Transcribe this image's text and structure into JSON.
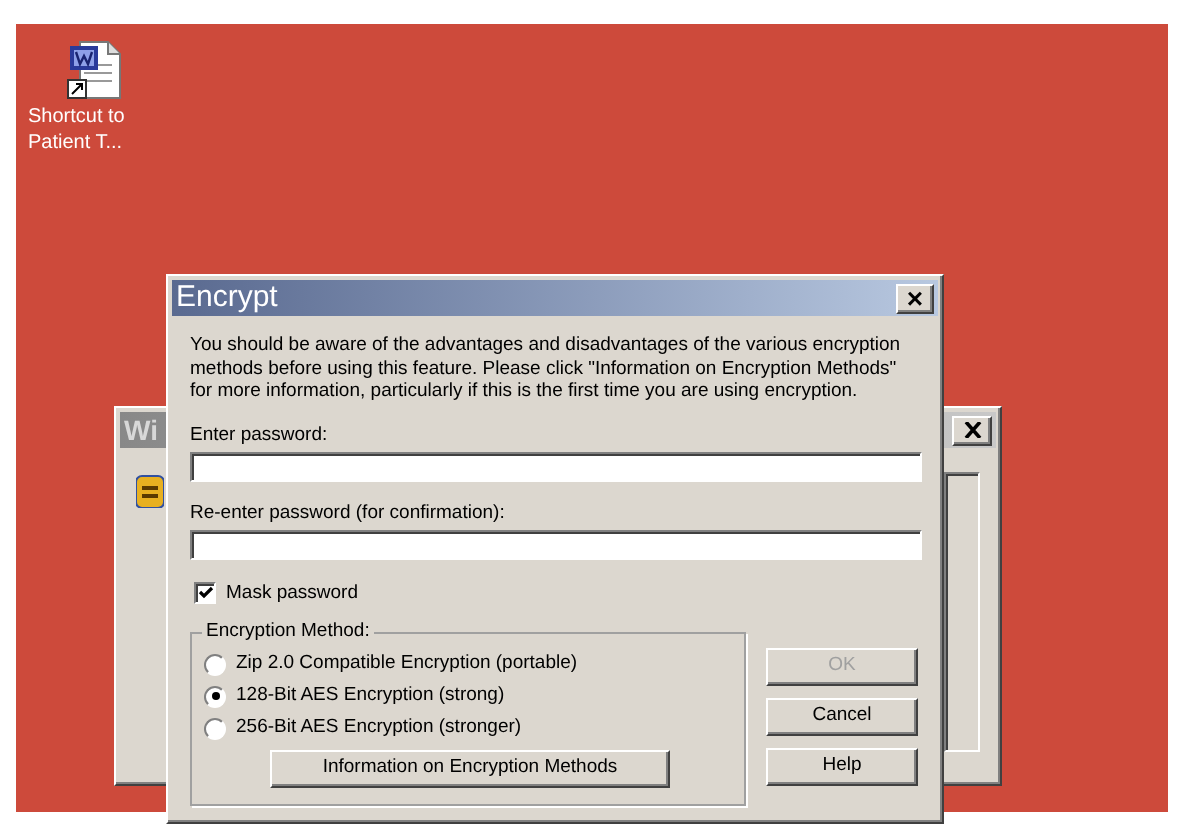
{
  "desktop_icons": [
    {
      "label": "Shortcut to Patient T..."
    }
  ],
  "background_window": {
    "title": "Wi"
  },
  "dialog": {
    "title": "Encrypt",
    "close": "×",
    "message": "You should be aware of the advantages and disadvantages of the various encryption methods before using this feature. Please click \"Information on Encryption Methods\" for more information, particularly if this is the first time you are using encryption.",
    "fields": [
      {
        "label": "Enter password:"
      },
      {
        "label": "Re-enter password (for confirmation):"
      }
    ],
    "mask_password": {
      "label": "Mask password",
      "checked": true
    },
    "encryption_method": {
      "title": "Encryption Method:",
      "options": [
        {
          "label": "Zip 2.0 Compatible Encryption (portable)",
          "selected": false
        },
        {
          "label": "128-Bit AES Encryption (strong)",
          "selected": true
        },
        {
          "label": "256-Bit AES Encryption (stronger)",
          "selected": false
        }
      ],
      "info_button": "Information on Encryption Methods"
    },
    "buttons": [
      {
        "label": "OK",
        "disabled": true
      },
      {
        "label": "Cancel",
        "disabled": false
      },
      {
        "label": "Help",
        "disabled": false
      }
    ]
  }
}
